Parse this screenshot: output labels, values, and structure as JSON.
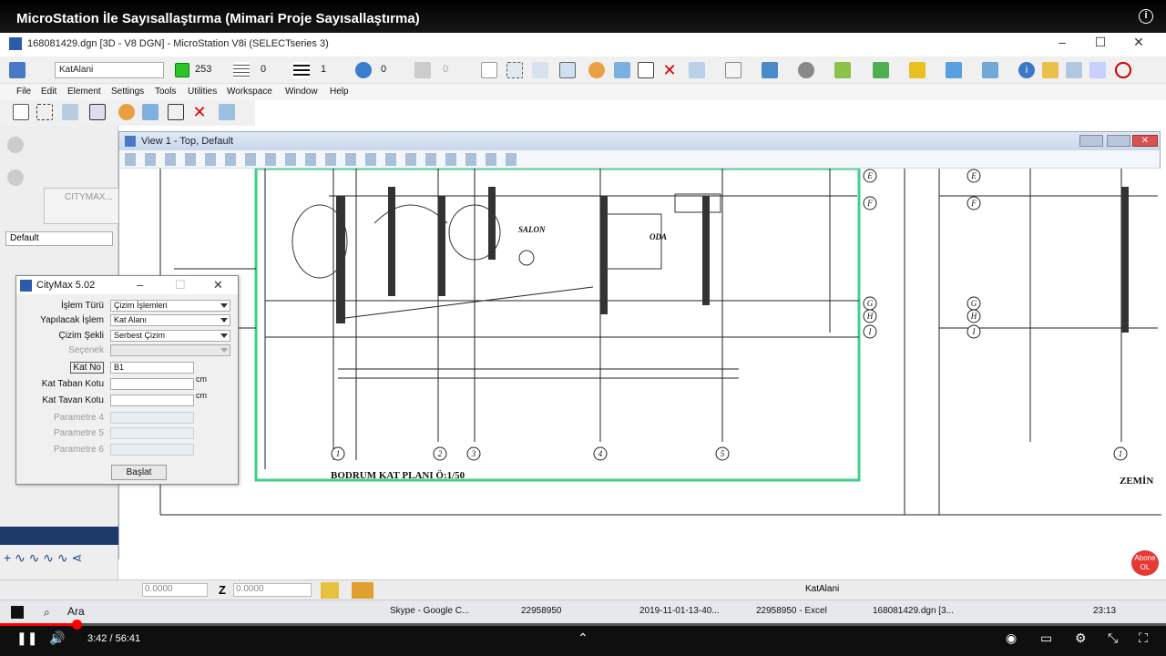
{
  "video": {
    "title": "MicroStation İle Sayısallaştırma (Mimari Proje Sayısallaştırma)",
    "time": "3:42 / 56:41",
    "progress": 0.0653
  },
  "app": {
    "window_title": "168081429.dgn [3D - V8 DGN] - MicroStation V8i (SELECTseries 3)",
    "level": "KatAlani",
    "color_num": "253",
    "line_style": "0",
    "line_weight": "1",
    "transparency": "0",
    "priority": "0",
    "accent": "#2a5caa"
  },
  "menu": [
    "File",
    "Edit",
    "Element",
    "Settings",
    "Tools",
    "Utilities",
    "Workspace",
    "Window",
    "Help"
  ],
  "left_panel": {
    "default_combo": "Default",
    "mini_dialog_title": "CITYMAX..."
  },
  "view": {
    "title": "View 1 - Top, Default",
    "plan_title": "BODRUM KAT PLANI Ö:1/50",
    "room1": "SALON",
    "room2": "ODA",
    "right_text": "ZEMİN",
    "axis_letters": [
      "E",
      "F",
      "G",
      "H",
      "I"
    ],
    "axis_numbers": [
      "1",
      "2",
      "3",
      "4",
      "5"
    ]
  },
  "dialog": {
    "title": "CityMax 5.02",
    "labels": {
      "islem_turu": "İşlem Türü",
      "yapilacak": "Yapılacak İşlem",
      "cizim_sekli": "Çizim Şekli",
      "secenek": "Seçenek",
      "kat_no": "Kat No",
      "taban": "Kat Taban Kotu",
      "tavan": "Kat Tavan Kotu",
      "p4": "Parametre 4",
      "p5": "Parametre 5",
      "p6": "Parametre 6"
    },
    "values": {
      "islem_turu": "Çizim İşlemleri",
      "yapilacak": "Kat Alanı",
      "cizim_sekli": "Serbest Çizim",
      "kat_no": "B1"
    },
    "unit": "cm",
    "button": "Başlat"
  },
  "status": {
    "z_label": "Z",
    "z_value": "0.0000",
    "x_value": "0.0000",
    "level": "KatAlani"
  },
  "taskbar": {
    "search": "Ara",
    "items": [
      "Skype - Google C...",
      "22958950",
      "2019-11-01-13-40...",
      "22958950 - Excel",
      "168081429.dgn [3..."
    ],
    "clock": "23:13"
  },
  "abone": "Abone OL"
}
